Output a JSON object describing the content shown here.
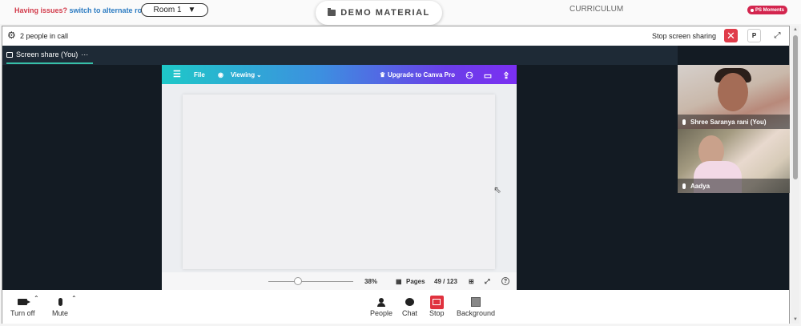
{
  "topbar": {
    "issues_text": "Having issues?",
    "alternate_link": "switch to alternate room",
    "room_selected": "Room 1",
    "demo_label": "DEMO MATERIAL",
    "curriculum_label": "CURRICULUM",
    "ps_badge": "PS Moments"
  },
  "call": {
    "people_count": "2 people in call",
    "stop_sharing": "Stop screen sharing",
    "p_label": "P",
    "share_tab": "Screen share (You)",
    "share_menu": "···"
  },
  "canva": {
    "file": "File",
    "viewing": "Viewing",
    "upgrade": "Upgrade to Canva Pro",
    "zoom": "38%",
    "pages_label": "Pages",
    "page_counter": "49 / 123",
    "zoom_slider_fraction": 0.35,
    "help": "?"
  },
  "participants": [
    {
      "name": "Shree Saranya rani (You)"
    },
    {
      "name": "Aadya"
    }
  ],
  "toolbar": {
    "turn_off": "Turn off",
    "mute": "Mute",
    "people": "People",
    "chat": "Chat",
    "stop": "Stop",
    "background": "Background"
  },
  "colors": {
    "accent_teal": "#37c0a8",
    "danger_red": "#e03c4a",
    "badge_pink": "#d3254e",
    "stage_dark": "#131b23"
  }
}
